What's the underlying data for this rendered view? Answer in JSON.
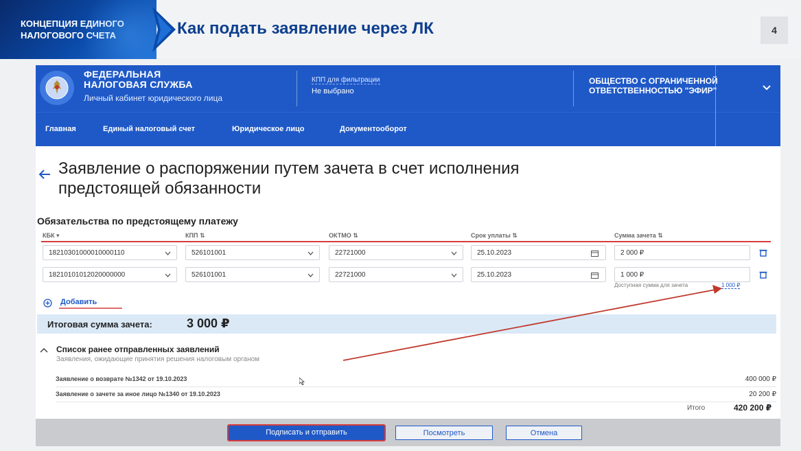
{
  "slide": {
    "brand_line1": "КОНЦЕПЦИЯ ЕДИНОГО",
    "brand_line2": "НАЛОГОВОГО СЧЕТА",
    "title": "Как подать заявление через ЛК",
    "page_number": "4"
  },
  "header": {
    "fns_line1": "ФЕДЕРАЛЬНАЯ",
    "fns_line2": "НАЛОГОВАЯ СЛУЖБА",
    "cabinet": "Личный кабинет юридического лица",
    "kpp_label": "КПП для фильтрации",
    "kpp_value": "Не выбрано",
    "org_line1": "ОБЩЕСТВО С ОГРАНИЧЕННОЙ",
    "org_line2": "ОТВЕТСТВЕННОСТЬЮ \"ЭФИР\""
  },
  "nav": {
    "items": [
      "Главная",
      "Единый налоговый счет",
      "Юридическое лицо",
      "Документооборот"
    ]
  },
  "page": {
    "heading_line1": "Заявление о распоряжении путем зачета в счет исполнения",
    "heading_line2": "предстоящей обязанности",
    "section_title": "Обязательства по предстоящему платежу"
  },
  "table": {
    "columns": [
      "КБК",
      "КПП",
      "ОКТМО",
      "Срок уплаты",
      "Сумма зачета"
    ],
    "rows": [
      {
        "kbk": "18210301000010000110",
        "kpp": "526101001",
        "oktmo": "22721000",
        "due": "25.10.2023",
        "sum": "2 000 ₽"
      },
      {
        "kbk": "18210101012020000000",
        "kpp": "526101001",
        "oktmo": "22721000",
        "due": "25.10.2023",
        "sum": "1 000 ₽"
      }
    ],
    "available_label": "Доступная сумма для зачета",
    "available_value": "1 000 ₽",
    "add_label": "Добавить"
  },
  "total": {
    "label": "Итоговая сумма зачета:",
    "value": "3 000 ₽"
  },
  "previous": {
    "title": "Список ранее отправленных заявлений",
    "subtitle": "Заявления, ожидающие принятия решения налоговым органом",
    "items": [
      {
        "name": "Заявление о возврате №1342 от 19.10.2023",
        "amount": "400 000 ₽"
      },
      {
        "name": "Заявление о зачете за иное лицо №1340 от 19.10.2023",
        "amount": "20 200 ₽"
      }
    ],
    "total_label": "Итого",
    "total_value": "420 200 ₽"
  },
  "footer": {
    "sign_send": "Подписать и отправить",
    "preview": "Посмотреть",
    "cancel": "Отмена"
  },
  "colors": {
    "primary": "#1f59c7",
    "highlight": "#d63b3b",
    "total_bg": "#dbe9f7"
  }
}
